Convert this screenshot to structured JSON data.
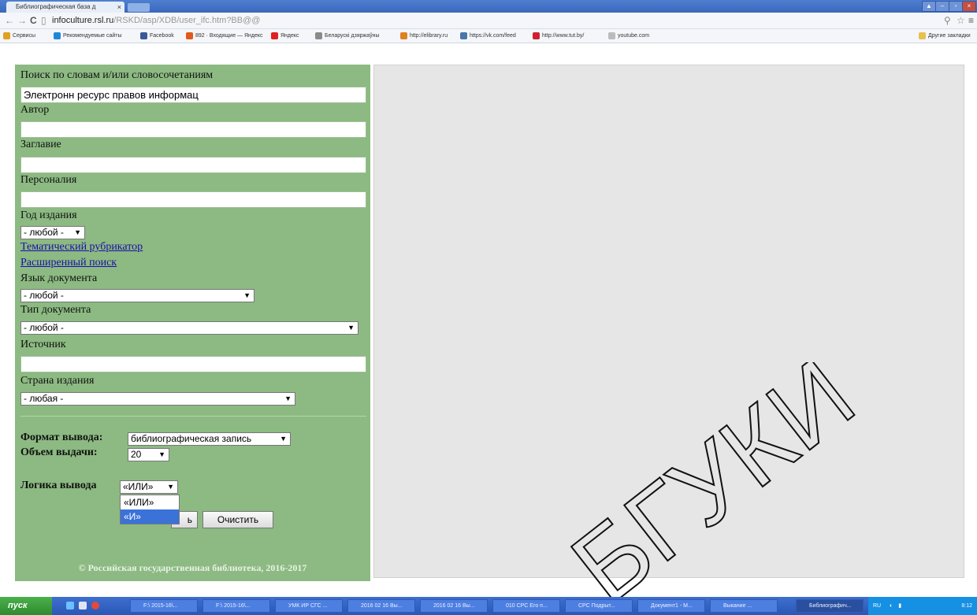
{
  "browser": {
    "tab_title": "Библиографическая база д",
    "tab_close": "×",
    "url_host": "infoculture.rsl.ru",
    "url_path": "/RSKD/asp/XDB/user_ifc.htm?BB@@",
    "window_controls": [
      "▲",
      "–",
      "▫",
      "×"
    ],
    "bookmarks": [
      {
        "label": "Сервисы",
        "color": "#e0a020"
      },
      {
        "label": "Рекомендуемые сайты",
        "color": "#1e88d8"
      },
      {
        "label": "Facebook",
        "color": "#3b5998"
      },
      {
        "label": "892 · Входящие — Яндекс",
        "color": "#e05a1e"
      },
      {
        "label": "Яндекс",
        "color": "#e02020"
      },
      {
        "label": "Беларускі дзяржаўны",
        "color": "#8a8a8a"
      },
      {
        "label": "http://elibrary.ru",
        "color": "#e08020"
      },
      {
        "label": "https://vk.com/feed",
        "color": "#4a76a8"
      },
      {
        "label": "http://www.tut.by/",
        "color": "#d02030"
      },
      {
        "label": "youtube.com",
        "color": "#bbbbbb"
      }
    ],
    "other_bookmarks": "Другие закладки"
  },
  "form": {
    "keywords_label": "Поиск по словам и/или словосочетаниям",
    "keywords_value": "Электронн ресурс правов информац",
    "author_label": "Автор",
    "title_label": "Заглавие",
    "person_label": "Персоналия",
    "year_label": "Год издания",
    "year_value": "- любой -",
    "rubricator_link": "Тематический рубрикатор",
    "advanced_link": "Расширенный поиск",
    "language_label": "Язык документа",
    "language_value": "- любой -",
    "doctype_label": "Тип документа",
    "doctype_value": "- любой -",
    "source_label": "Источник",
    "country_label": "Страна издания",
    "country_value": "- любая -",
    "format_label": "Формат вывода:",
    "format_value": "библиографическая запись",
    "volume_label": "Объем выдачи:",
    "volume_value": "20",
    "logic_label": "Логика вывода",
    "logic_value": "«ИЛИ»",
    "logic_options": [
      "«ИЛИ»",
      "«И»"
    ],
    "search_button_fragment": "ь",
    "clear_button": "Очистить",
    "footer": "© Российская государственная библиотека, 2016-2017"
  },
  "watermark": "БГУКИ",
  "taskbar": {
    "start_label": "пуск",
    "tasks": [
      "F:\\ 2015-16\\...",
      "F:\\ 2015-16\\...",
      "УМК ИР СГС ...",
      "2016 02 16 Вы...",
      "2016 02 16 Вы...",
      "010 СРС Его п...",
      "СРС Подрыт...",
      "Документ1 - M...",
      "Выкание ...",
      "Библиографич..."
    ],
    "tray_lang": "RU",
    "clock": "8:12"
  }
}
